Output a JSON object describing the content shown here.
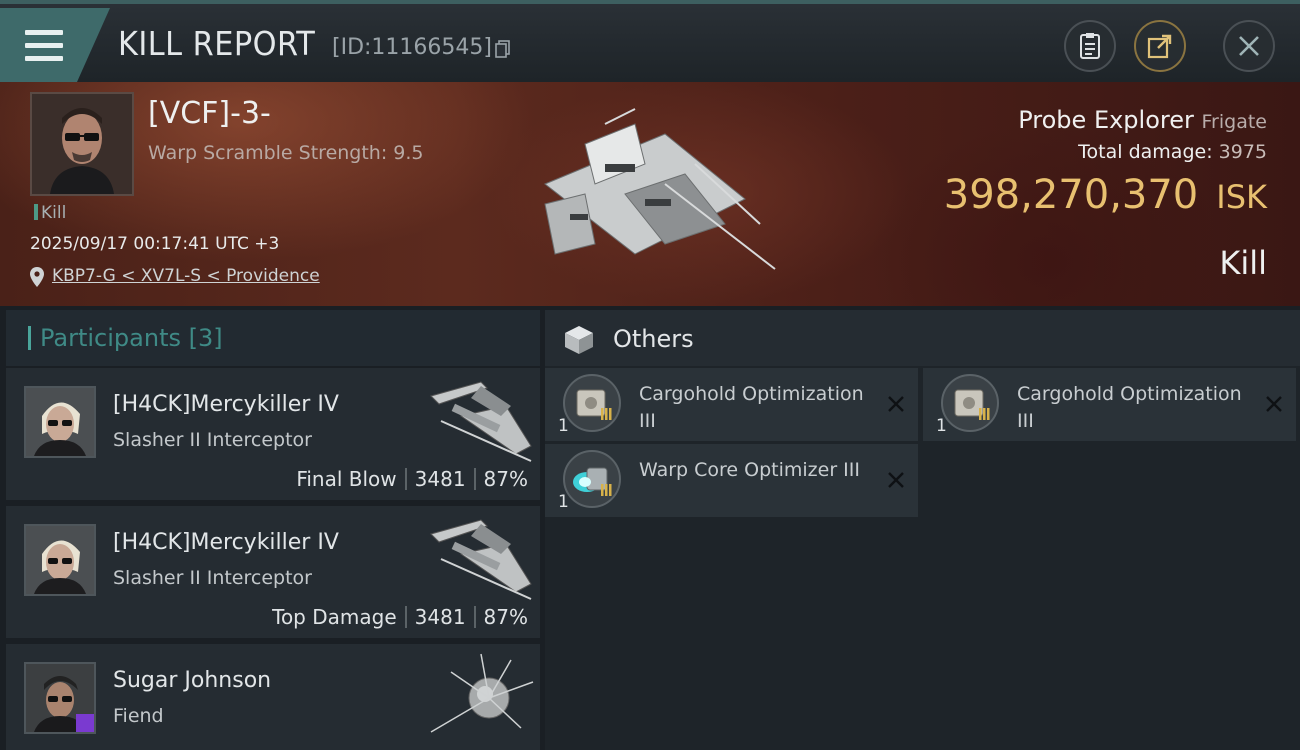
{
  "header": {
    "title": "KILL REPORT",
    "report_id": "[ID:11166545]",
    "icons": [
      "menu-icon",
      "copy-icon",
      "clipboard-icon",
      "share-icon",
      "close-icon"
    ]
  },
  "victim": {
    "name": "[VCF]-3-",
    "scramble": "Warp Scramble Strength: 9.5",
    "tag": "Kill",
    "datetime": "2025/09/17 00:17:41 UTC +3",
    "location": "KBP7-G < XV7L-S < Providence",
    "ship_name": "Probe Explorer",
    "ship_class": "Frigate",
    "total_damage_label": "Total damage:",
    "total_damage": "3975",
    "isk_value": "398,270,370",
    "isk_unit": "ISK",
    "result": "Kill"
  },
  "participants": {
    "label": "Participants",
    "count": "[3]",
    "rows": [
      {
        "name": "[H4CK]Mercykiller IV",
        "ship": "Slasher II Interceptor",
        "role": "Final Blow",
        "damage": "3481",
        "percent": "87%"
      },
      {
        "name": "[H4CK]Mercykiller IV",
        "ship": "Slasher II Interceptor",
        "role": "Top Damage",
        "damage": "3481",
        "percent": "87%"
      },
      {
        "name": "Sugar Johnson",
        "ship": "Fiend",
        "role": "",
        "damage": "",
        "percent": ""
      }
    ]
  },
  "others": {
    "label": "Others",
    "items": [
      {
        "qty": "1",
        "name": "Cargohold Optimization III"
      },
      {
        "qty": "1",
        "name": "Cargohold Optimization III"
      },
      {
        "qty": "1",
        "name": "Warp Core Optimizer III"
      }
    ]
  },
  "colors": {
    "accent": "#4aa59b",
    "isk": "#e8c070",
    "banner": "#5c2a1e"
  }
}
